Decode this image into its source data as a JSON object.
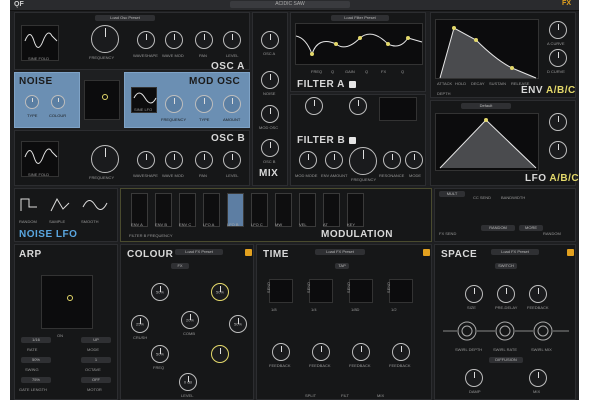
{
  "topbar": {
    "logo": "ǪF",
    "preset": "ACIDIC SAW",
    "fx": "FX"
  },
  "osc_a": {
    "title": "OSC A",
    "wave_label": "SINE FOLD",
    "preset": "Load Osc Preset",
    "knobs": [
      "FREQUENCY",
      "WAVESHAPE",
      "WAVE MOD",
      "PAN",
      "LEVEL"
    ]
  },
  "noise": {
    "title": "NOISE",
    "knobs": [
      "TYPE",
      "COLOUR"
    ]
  },
  "mod_osc": {
    "title": "MOD OSC",
    "knobs": [
      "FREQUENCY",
      "TYPE",
      "AMOUNT"
    ],
    "wave": "SINE LFO"
  },
  "osc_b": {
    "title": "OSC B",
    "wave_label": "SINE FOLD",
    "knobs": [
      "FREQUENCY",
      "WAVESHAPE",
      "WAVE MOD",
      "PAN",
      "LEVEL"
    ]
  },
  "mix": {
    "title": "MIX",
    "knobs": [
      "OSC A",
      "NOISE",
      "MOD OSC",
      "OSC B"
    ]
  },
  "filter_a": {
    "title": "FILTER A",
    "preset": "Load Filter Preset",
    "params": [
      "FREQ",
      "Q",
      "GAIN",
      "Q",
      "FX",
      "Q"
    ],
    "values": [
      "330 Hz",
      "2.0",
      "0.0 dB",
      "3.0",
      "1.2",
      "0.6"
    ],
    "knobs": [
      "MIX",
      "DRIVE"
    ]
  },
  "filter_b": {
    "title": "FILTER B",
    "knobs": [
      "MOD MODE",
      "ENV AMOUNT",
      "FREQUENCY",
      "RESONANCE",
      "MODE"
    ]
  },
  "env": {
    "title": "ENV",
    "title_sel": "A/B/C",
    "params": [
      "ATTACK",
      "HOLD",
      "DECAY",
      "SUSTAIN",
      "RELEASE"
    ],
    "values": [
      "0.0",
      "10 ms",
      "200 ms",
      "-6 dB",
      "500 ms"
    ],
    "knobs": [
      "A CURVE",
      "D CURVE",
      "R CURVE"
    ],
    "depth": "DEPTH"
  },
  "lfo": {
    "title": "LFO",
    "title_sel": "A/B/C",
    "preset": "Default",
    "knobs": [
      "RATE",
      "PHASE",
      "DEPTH"
    ]
  },
  "noise_lfo": {
    "title": "NOISE LFO",
    "items": [
      "RANDOM",
      "SAMPLE",
      "SMOOTH"
    ]
  },
  "modulation": {
    "title": "MODULATION",
    "hint": "FILTER B FREQUENCY",
    "slots": [
      "ENV A",
      "ENV B",
      "ENV C",
      "LFO A",
      "LFO B",
      "LFO C",
      "MW",
      "VEL",
      "AT",
      "KEY"
    ],
    "active_index": 4,
    "right": {
      "labels": [
        "FX SEND",
        "CC SEND",
        "BANDWIDTH",
        "RANDOM"
      ],
      "pills": [
        "MULT",
        "RANDOM",
        "MORE"
      ]
    }
  },
  "arp": {
    "title": "ARP",
    "toggle": "ON",
    "params": [
      "RATE",
      "MODE",
      "SWING",
      "OCTAVE",
      "GATE LENGTH",
      "MOTOR"
    ],
    "values": [
      "1/16",
      "UP",
      "50%",
      "1",
      "75%",
      "OFF"
    ]
  },
  "colour": {
    "title": "COLOUR",
    "preset": "Load FX Preset",
    "badge": "FX",
    "knobs": [
      "DRIVE",
      "CRUSH",
      "DRIVE",
      "COMB",
      "DRIVE",
      "TRIM",
      "FREQ",
      "LEVEL"
    ],
    "values": [
      "50%",
      "25%",
      "50%",
      "20%",
      "50%",
      "50%",
      "0 dB"
    ]
  },
  "time": {
    "title": "TIME",
    "preset": "Load FX Preset",
    "badge": "TAP",
    "sends": [
      "SEND",
      "SEND",
      "SEND",
      "SEND"
    ],
    "knobs": [
      "FEEDBACK",
      "FEEDBACK",
      "FEEDBACK",
      "FEEDBACK"
    ],
    "bottom": [
      "SPLIT",
      "FILT",
      "MIX"
    ],
    "values": [
      "1/8",
      "1/4",
      "1/8D",
      "1/2"
    ]
  },
  "space": {
    "title": "SPACE",
    "preset": "Load FX Preset",
    "badge": "SWITCH",
    "knobs": [
      "SIZE",
      "PRE-DELAY",
      "FEEDBACK",
      "DIFFUSION",
      "DAMP",
      "MIX"
    ],
    "mods": [
      "SWIRL DEPTH",
      "SWIRL RATE",
      "SWIRL MIX"
    ]
  }
}
